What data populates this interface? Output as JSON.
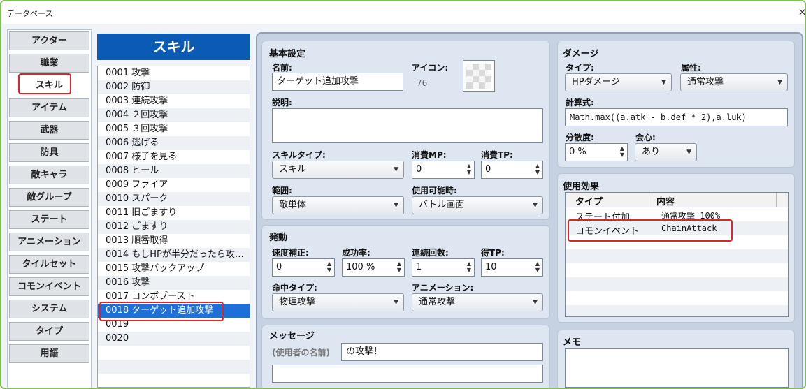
{
  "window": {
    "title": "データベース",
    "close": "×"
  },
  "nav": {
    "items": [
      "アクター",
      "職業",
      "スキル",
      "アイテム",
      "武器",
      "防具",
      "敵キャラ",
      "敵グループ",
      "ステート",
      "アニメーション",
      "タイルセット",
      "コモンイベント",
      "システム",
      "タイプ",
      "用語"
    ],
    "active_index": 2
  },
  "skills": {
    "header": "スキル",
    "items": [
      "0001 攻撃",
      "0002 防御",
      "0003 連続攻撃",
      "0004 ２回攻撃",
      "0005 ３回攻撃",
      "0006 逃げる",
      "0007 様子を見る",
      "0008 ヒール",
      "0009 ファイア",
      "0010 スパーク",
      "0011 旧ごますり",
      "0012 ごますり",
      "0013 順番取得",
      "0014 もしHPが半分だったら攻…",
      "0015 攻撃バックアップ",
      "0016 攻撃",
      "0017 コンボブースト",
      "0018 ターゲット追加攻撃",
      "0019",
      "0020"
    ],
    "selected_index": 17
  },
  "basic": {
    "title": "基本設定",
    "name_label": "名前:",
    "name_value": "ターゲット追加攻撃",
    "icon_label": "アイコン:",
    "icon_index": "76",
    "desc_label": "説明:",
    "desc_value": "",
    "skill_type_label": "スキルタイプ:",
    "skill_type_value": "スキル",
    "mp_label": "消費MP:",
    "mp_value": "0",
    "tp_label": "消費TP:",
    "tp_value": "0",
    "scope_label": "範囲:",
    "scope_value": "敵単体",
    "occasion_label": "使用可能時:",
    "occasion_value": "バトル画面"
  },
  "invocation": {
    "title": "発動",
    "speed_label": "速度補正:",
    "speed_value": "0",
    "success_label": "成功率:",
    "success_value": "100 %",
    "repeat_label": "連続回数:",
    "repeat_value": "1",
    "tpgain_label": "得TP:",
    "tpgain_value": "10",
    "hit_label": "命中タイプ:",
    "hit_value": "物理攻撃",
    "anim_label": "アニメーション:",
    "anim_value": "通常攻撃"
  },
  "message": {
    "title": "メッセージ",
    "user_name_tag": "(使用者の名前)",
    "line1": "の攻撃！",
    "line2": ""
  },
  "damage": {
    "title": "ダメージ",
    "type_label": "タイプ:",
    "type_value": "HPダメージ",
    "element_label": "属性:",
    "element_value": "通常攻撃",
    "formula_label": "計算式:",
    "formula_value": "Math.max((a.atk - b.def * 2),a.luk)",
    "variance_label": "分散度:",
    "variance_value": "0 %",
    "critical_label": "会心:",
    "critical_value": "あり"
  },
  "effects": {
    "title": "使用効果",
    "col_type": "タイプ",
    "col_content": "内容",
    "rows": [
      {
        "type": "ステート付加",
        "content": "通常攻撃 100%"
      },
      {
        "type": "コモンイベント",
        "content": "ChainAttack"
      }
    ]
  },
  "memo": {
    "title": "メモ",
    "value": ""
  },
  "colors": {
    "accent": "#0b5bb5",
    "selection": "#1e6fd9",
    "highlight": "#e0242a",
    "window_border": "#7dc24b"
  }
}
